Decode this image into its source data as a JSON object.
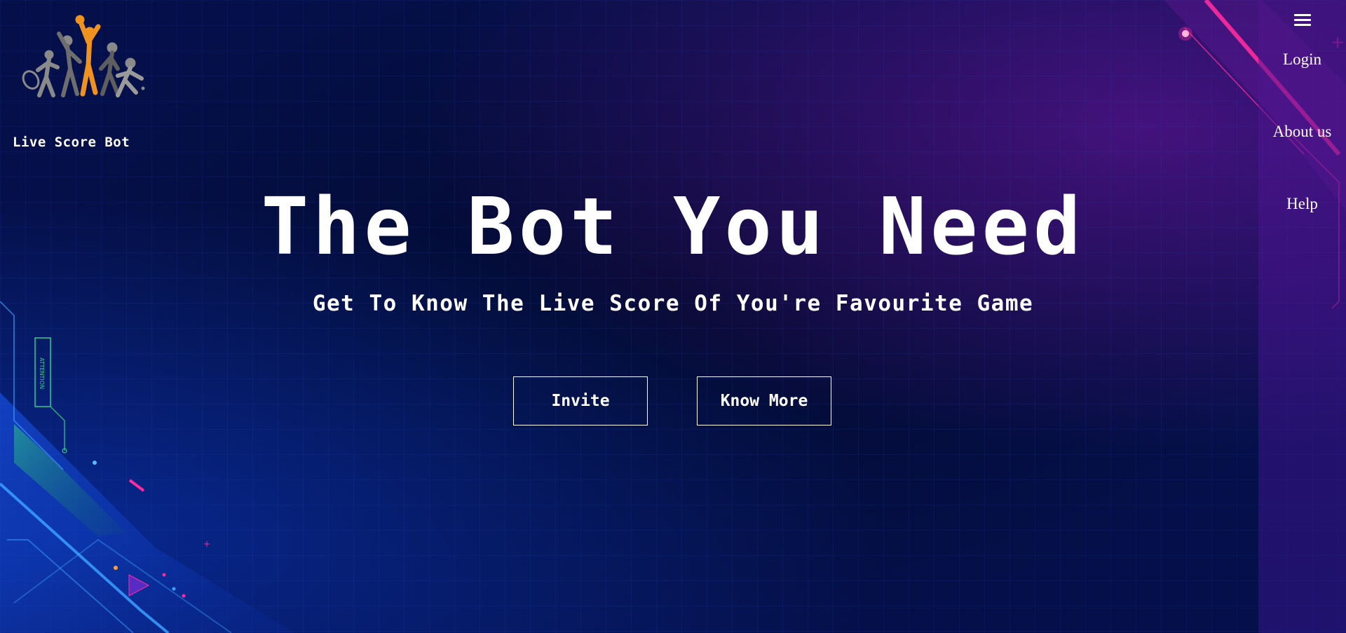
{
  "brand": {
    "name": "Live Score Bot",
    "logo_icon": "sports-figures-logo",
    "logo_accent_color": "#f0921e",
    "logo_figure_color": "#8a8a8a"
  },
  "nav": {
    "menu_icon": "hamburger-icon",
    "items": [
      {
        "label": "Login"
      },
      {
        "label": "About us"
      },
      {
        "label": "Help"
      }
    ]
  },
  "hero": {
    "title": "The Bot You Need",
    "subtitle": "Get To Know The Live Score Of You're Favourite Game",
    "buttons": {
      "invite_label": "Invite",
      "know_more_label": "Know More"
    }
  },
  "decor": {
    "left_panel_text": "ATTENTION",
    "accent_pink": "#ff2a9e",
    "accent_cyan": "#3aa0ff",
    "accent_green": "#2ecc8a"
  },
  "theme": {
    "background": "#030b35",
    "text": "#ffffff"
  }
}
